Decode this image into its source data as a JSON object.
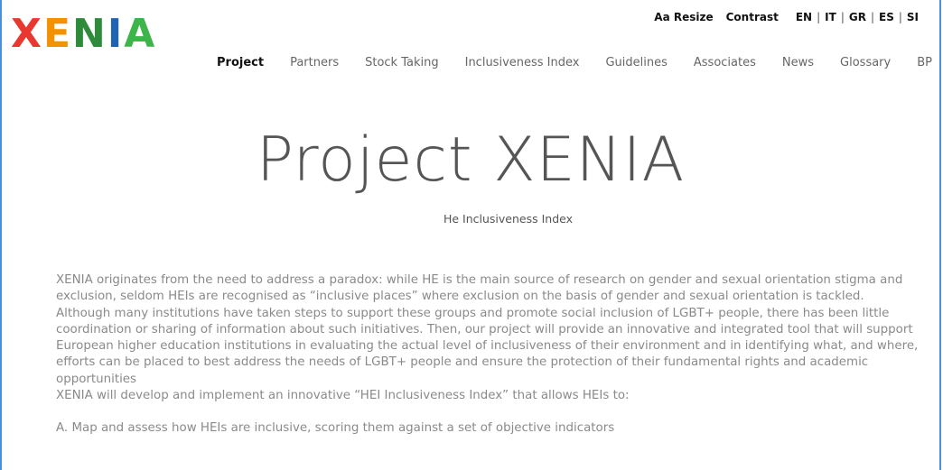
{
  "logo": {
    "letters": [
      {
        "char": "X",
        "color": "#e8382f"
      },
      {
        "char": "E",
        "color": "#f39200"
      },
      {
        "char": "N",
        "color": "#2e8b3a"
      },
      {
        "char": "I",
        "color": "#1f63b5"
      },
      {
        "char": "A",
        "color": "#3db54a"
      }
    ]
  },
  "topbar": {
    "resize_label": "Aa Resize",
    "contrast_label": "Contrast",
    "languages": [
      "EN",
      "IT",
      "GR",
      "ES",
      "SI"
    ],
    "separator": "|"
  },
  "nav": {
    "items": [
      "Project",
      "Partners",
      "Stock Taking",
      "Inclusiveness Index",
      "Guidelines",
      "Associates",
      "News",
      "Glossary",
      "BP"
    ],
    "active_index": 0
  },
  "main": {
    "title": "Project XENIA",
    "subtitle": "He Inclusiveness Index",
    "paragraphs": [
      "XENIA originates from the need to address a paradox: while HE is the main source of research on gender and sexual orientation stigma and exclusion, seldom HEIs are recognised as “inclusive places” where exclusion on the basis of gender and sexual orientation is tackled.",
      "Although many institutions have taken steps to support these groups and promote social inclusion of LGBT+ people, there has been little coordination or sharing of information about such initiatives. Then, our project will provide an innovative and integrated tool that will support European higher education institutions in evaluating the actual level of inclusiveness of their environment and in identifying what, and where, efforts can be placed to best address the needs of LGBT+ people and ensure the protection of their fundamental rights and academic opportunities",
      "XENIA will develop and implement an innovative “HEI Inclusiveness Index” that allows HEIs to:"
    ],
    "list_items": [
      "A. Map and assess how HEIs are inclusive, scoring them against a set of objective indicators"
    ]
  },
  "colors": {
    "frame_border": "#4a90d9",
    "body_text": "#8a8a8a",
    "nav_text": "#666666",
    "nav_active": "#111111"
  }
}
